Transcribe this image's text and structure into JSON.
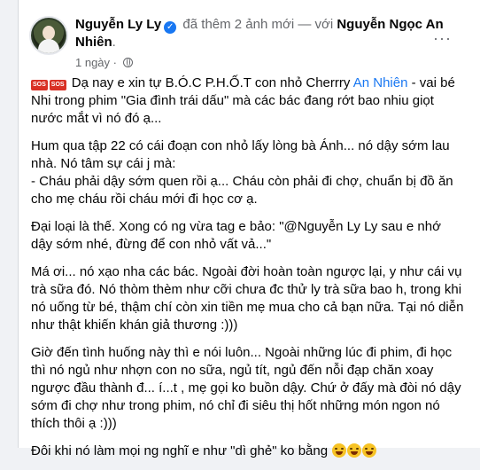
{
  "post": {
    "author": "Nguyễn Ly Ly",
    "action_text": "đã thêm 2 ảnh mới — với",
    "tagged": "Nguyễn Ngọc An Nhiên",
    "title_end": ".",
    "time": "1 ngày",
    "meta_separator": "·",
    "verified_glyph": "✓",
    "more_glyph": "···"
  },
  "icons": {
    "avatar": "avatar",
    "verified": "verified-badge-icon",
    "privacy": "globe-icon",
    "more": "more-options-icon",
    "sos": "sos-emoji",
    "laugh": "grinning-squinting-emoji",
    "accent": "#1877f2"
  },
  "body": {
    "p1_sos1": "SOS",
    "p1_sos2": "SOS",
    "p1_a": " Dạ nay e xin tự B.Ó.C P.H.Ố.T con nhỏ Cherrry ",
    "p1_link": "An Nhiên",
    "p1_b": " - vai bé Nhi trong phim \"Gia đình trái dấu\" mà các bác đang rớt bao nhiu giọt nước mắt vì nó đó ạ...",
    "p2_a": "Hum qua tập 22 có cái đoạn con nhỏ lấy lòng bà Ánh... nó dậy sớm lau nhà. Nó tâm sự cái j mà:",
    "p2_b": "- Cháu phải dậy sớm quen rồi ạ... Cháu còn phải đi chợ, chuẩn bị đồ ăn cho mẹ cháu rồi cháu mới đi học cơ ạ.",
    "p3": "Đại loại là thế. Xong có ng vừa tag e bảo: \"@Nguyễn Ly Ly sau e nhớ dậy sớm nhé, đừng để con nhỏ vất vả...\"",
    "p4": "Má ơi... nó xạo nha các bác. Ngoài đời hoàn toàn ngược lại, y như cái vụ trà sữa đó. Nó thòm thèm như cỡi chưa đc thử ly trà sữa bao h, trong khi nó uống từ bé, thậm chí còn xin tiền mẹ mua cho cả bạn nữa. Tại nó diễn như thật khiến khán giả thương :)))",
    "p5": "Giờ đến tình huống này thì e nói luôn... Ngoài những lúc đi phim, đi học thì nó ngủ như nhợn con no sữa, ngủ tít, ngủ đến nỗi đạp chăn xoay ngược đầu thành đ... í...t , mẹ gọi ko buồn dậy. Chứ ở đấy mà đòi nó dậy sớm đi chợ như trong phim, nó chỉ đi siêu thị hốt những món ngon nó thích thôi ạ :)))",
    "p6": "Đôi khi nó làm mọi ng nghĩ e như \"dì ghẻ\" ko bằng "
  }
}
